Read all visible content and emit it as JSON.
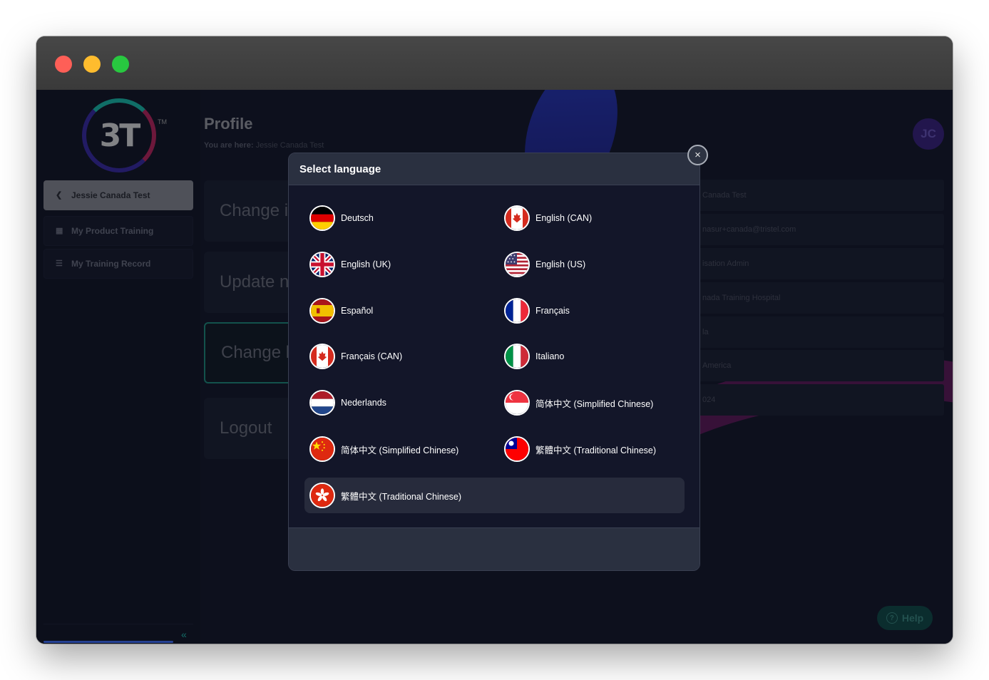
{
  "window": {
    "traffic_lights": [
      "close",
      "minimize",
      "maximize"
    ]
  },
  "sidebar": {
    "logo_text": "3T",
    "logo_tm": "TM",
    "items": [
      {
        "label": "Jessie Canada Test",
        "icon": "chevron-left-icon",
        "active": true
      },
      {
        "label": "My Product Training",
        "icon": "grid-icon",
        "active": false
      },
      {
        "label": "My Training Record",
        "icon": "list-icon",
        "active": false
      }
    ],
    "collapse_glyph": "«"
  },
  "main": {
    "title": "Profile",
    "breadcrumb_prefix": "You are here:",
    "breadcrumb_current": "Jessie Canada Test",
    "avatar_initials": "JC",
    "actions": [
      "Change i",
      "Update n",
      "Change l",
      "Logout"
    ],
    "info_rows": [
      "Canada Test",
      "nasur+canada@tristel.com",
      "isation Admin",
      "nada Training Hospital",
      "la",
      "America",
      "024"
    ],
    "help_label": "Help",
    "help_icon": "?"
  },
  "modal": {
    "title": "Select language",
    "close_glyph": "×",
    "languages": [
      {
        "label": "Deutsch",
        "flag": "de"
      },
      {
        "label": "English (CAN)",
        "flag": "ca"
      },
      {
        "label": "English (UK)",
        "flag": "gb"
      },
      {
        "label": "English (US)",
        "flag": "us"
      },
      {
        "label": "Español",
        "flag": "es"
      },
      {
        "label": "Français",
        "flag": "fr"
      },
      {
        "label": "Français (CAN)",
        "flag": "ca"
      },
      {
        "label": "Italiano",
        "flag": "it"
      },
      {
        "label": "Nederlands",
        "flag": "nl"
      },
      {
        "label": "简体中文 (Simplified Chinese)",
        "flag": "sg"
      },
      {
        "label": "简体中文 (Simplified Chinese)",
        "flag": "cn"
      },
      {
        "label": "繁體中文 (Traditional Chinese)",
        "flag": "tw"
      },
      {
        "label": "繁體中文 (Traditional Chinese)",
        "flag": "hk"
      }
    ]
  },
  "colors": {
    "accent": "#1fbfae",
    "avatar": "#3a2180",
    "modal_header": "#2a3040",
    "brand_red": "#fe5f57"
  }
}
